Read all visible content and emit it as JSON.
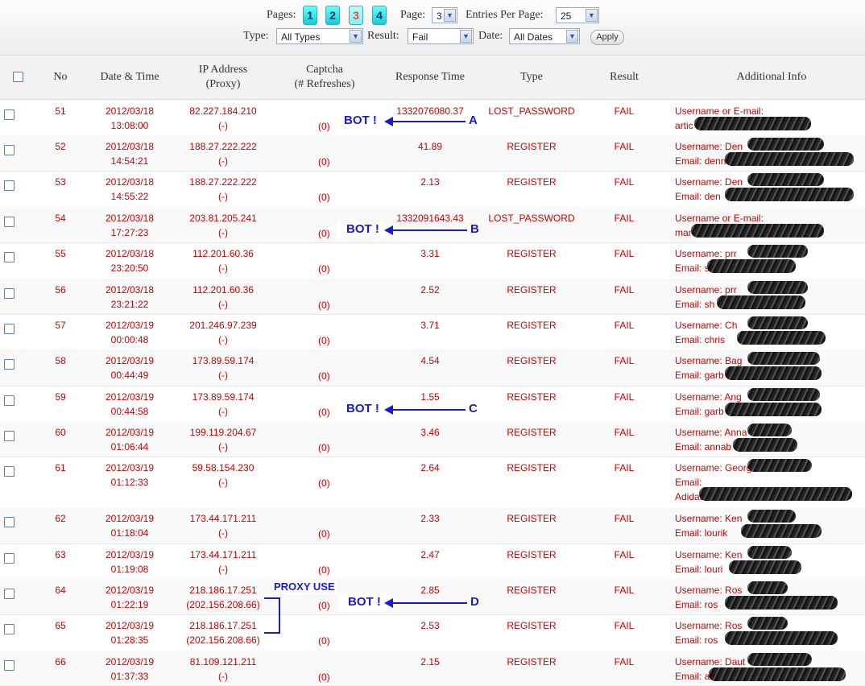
{
  "toolbar": {
    "pages_label": "Pages:",
    "pages": [
      "1",
      "2",
      "3",
      "4"
    ],
    "page_label": "Page:",
    "page_value": "3",
    "entries_label": "Entries Per Page:",
    "entries_value": "25",
    "type_label": "Type:",
    "type_value": "All Types",
    "result_label": "Result:",
    "result_value": "Fail",
    "date_label": "Date:",
    "date_value": "All Dates",
    "apply_label": "Apply"
  },
  "columns": {
    "no": "No",
    "datetime": "Date & Time",
    "ip_1": "IP Address",
    "ip_2": "(Proxy)",
    "captcha_1": "Captcha",
    "captcha_2": "(# Refreshes)",
    "response": "Response Time",
    "type": "Type",
    "result": "Result",
    "info": "Additional Info"
  },
  "rows": [
    {
      "no": "51",
      "date": "2012/03/18",
      "time": "13:08:00",
      "ip": "82.227.184.210",
      "proxy": "(-)",
      "captcha": "(0)",
      "response": "1332076080.37",
      "type": "LOST_PASSWORD",
      "result": "FAIL",
      "info1": "Username or E-mail:",
      "info2": "artic"
    },
    {
      "no": "52",
      "date": "2012/03/18",
      "time": "14:54:21",
      "ip": "188.27.222.222",
      "proxy": "(-)",
      "captcha": "(0)",
      "response": "41.89",
      "type": "REGISTER",
      "result": "FAIL",
      "info1": "Username: Den",
      "info2": "Email: denn"
    },
    {
      "no": "53",
      "date": "2012/03/18",
      "time": "14:55:22",
      "ip": "188.27.222.222",
      "proxy": "(-)",
      "captcha": "(0)",
      "response": "2.13",
      "type": "REGISTER",
      "result": "FAIL",
      "info1": "Username: Den",
      "info2": "Email: den"
    },
    {
      "no": "54",
      "date": "2012/03/18",
      "time": "17:27:23",
      "ip": "203.81.205.241",
      "proxy": "(-)",
      "captcha": "(0)",
      "response": "1332091643.43",
      "type": "LOST_PASSWORD",
      "result": "FAIL",
      "info1": "Username or E-mail:",
      "info2": "mar"
    },
    {
      "no": "55",
      "date": "2012/03/18",
      "time": "23:20:50",
      "ip": "112.201.60.36",
      "proxy": "(-)",
      "captcha": "(0)",
      "response": "3.31",
      "type": "REGISTER",
      "result": "FAIL",
      "info1": "Username: prr",
      "info2": "Email: sh"
    },
    {
      "no": "56",
      "date": "2012/03/18",
      "time": "23:21:22",
      "ip": "112.201.60.36",
      "proxy": "(-)",
      "captcha": "(0)",
      "response": "2.52",
      "type": "REGISTER",
      "result": "FAIL",
      "info1": "Username: prr",
      "info2": "Email: sh"
    },
    {
      "no": "57",
      "date": "2012/03/19",
      "time": "00:00:48",
      "ip": "201.246.97.239",
      "proxy": "(-)",
      "captcha": "(0)",
      "response": "3.71",
      "type": "REGISTER",
      "result": "FAIL",
      "info1": "Username: Ch",
      "info2": "Email: chris"
    },
    {
      "no": "58",
      "date": "2012/03/19",
      "time": "00:44:49",
      "ip": "173.89.59.174",
      "proxy": "(-)",
      "captcha": "(0)",
      "response": "4.54",
      "type": "REGISTER",
      "result": "FAIL",
      "info1": "Username: Bag",
      "info2": "Email: garb"
    },
    {
      "no": "59",
      "date": "2012/03/19",
      "time": "00:44:58",
      "ip": "173.89.59.174",
      "proxy": "(-)",
      "captcha": "(0)",
      "response": "1.55",
      "type": "REGISTER",
      "result": "FAIL",
      "info1": "Username: Ang",
      "info2": "Email: garb"
    },
    {
      "no": "60",
      "date": "2012/03/19",
      "time": "01:06:44",
      "ip": "199.119.204.67",
      "proxy": "(-)",
      "captcha": "(0)",
      "response": "3.46",
      "type": "REGISTER",
      "result": "FAIL",
      "info1": "Username: Anna",
      "info2": "Email: annab"
    },
    {
      "no": "61",
      "date": "2012/03/19",
      "time": "01:12:33",
      "ip": "59.58.154.230",
      "proxy": "(-)",
      "captcha": "(0)",
      "response": "2.64",
      "type": "REGISTER",
      "result": "FAIL",
      "info1": "Username: Georg",
      "info2": "Email:",
      "info3": "Adidas"
    },
    {
      "no": "62",
      "date": "2012/03/19",
      "time": "01:18:04",
      "ip": "173.44.171.211",
      "proxy": "(-)",
      "captcha": "(0)",
      "response": "2.33",
      "type": "REGISTER",
      "result": "FAIL",
      "info1": "Username: Ken",
      "info2": "Email: lourik"
    },
    {
      "no": "63",
      "date": "2012/03/19",
      "time": "01:19:08",
      "ip": "173.44.171.211",
      "proxy": "(-)",
      "captcha": "(0)",
      "response": "2.47",
      "type": "REGISTER",
      "result": "FAIL",
      "info1": "Username: Ken",
      "info2": "Email: louri"
    },
    {
      "no": "64",
      "date": "2012/03/19",
      "time": "01:22:19",
      "ip": "218.186.17.251",
      "proxy": "(202.156.208.66)",
      "captcha": "(0)",
      "response": "2.85",
      "type": "REGISTER",
      "result": "FAIL",
      "info1": "Username: Ros",
      "info2": "Email: ros"
    },
    {
      "no": "65",
      "date": "2012/03/19",
      "time": "01:28:35",
      "ip": "218.186.17.251",
      "proxy": "(202.156.208.66)",
      "captcha": "(0)",
      "response": "2.53",
      "type": "REGISTER",
      "result": "FAIL",
      "info1": "Username: Ros",
      "info2": "Email: ros"
    },
    {
      "no": "66",
      "date": "2012/03/19",
      "time": "01:37:33",
      "ip": "81.109.121.211",
      "proxy": "(-)",
      "captcha": "(0)",
      "response": "2.15",
      "type": "REGISTER",
      "result": "FAIL",
      "info1": "Username: Daut",
      "info2": "Email: am"
    }
  ],
  "annotations": {
    "bot": "BOT !",
    "a": "A",
    "b": "B",
    "c": "C",
    "d": "D",
    "proxy_use": "PROXY USE",
    "color": "#1a1ad0"
  }
}
